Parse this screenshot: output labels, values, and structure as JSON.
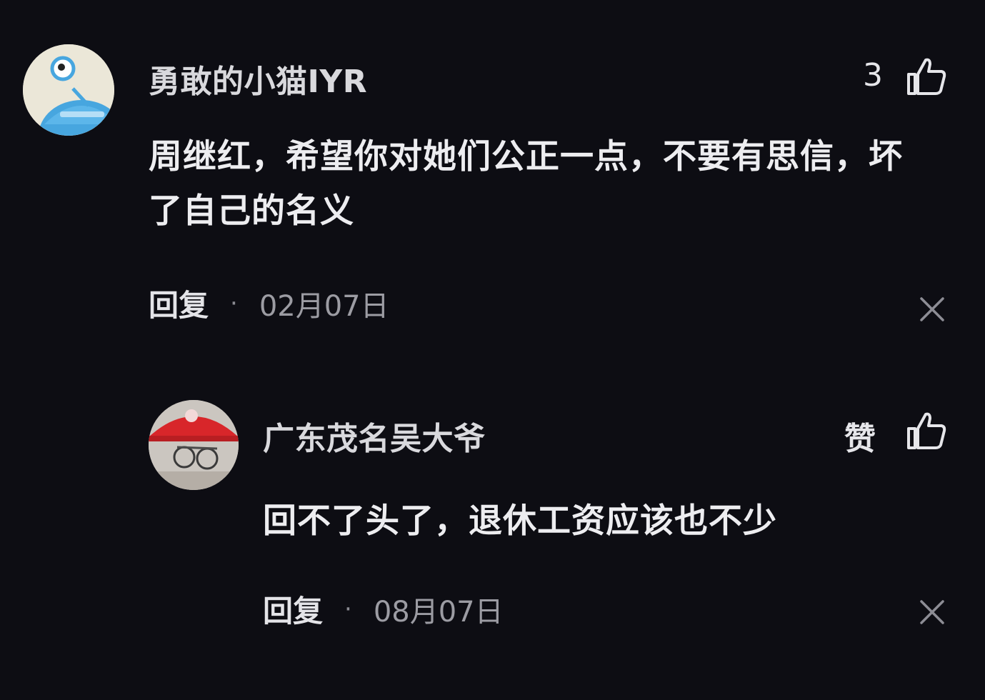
{
  "comments": [
    {
      "username": "勇敢的小猫IYR",
      "like_count": "3",
      "text": "周继红，希望你对她们公正一点，不要有思信，坏了自己的名义",
      "reply_label": "回复",
      "separator": "·",
      "date": "02月07日",
      "icons": {
        "like": "thumbs-up-icon",
        "close": "close-icon"
      }
    },
    {
      "username": "广东茂名吴大爷",
      "like_label": "赞",
      "text": "回不了头了，退休工资应该也不少",
      "reply_label": "回复",
      "separator": "·",
      "date": "08月07日",
      "icons": {
        "like": "thumbs-up-icon",
        "close": "close-icon"
      }
    }
  ],
  "colors": {
    "background": "#0d0d13",
    "text_primary": "#ededf0",
    "text_secondary": "#9c9ca3",
    "avatar1_bg": "#e9e5d6",
    "avatar1_accent": "#4aa8e0",
    "avatar2_accent": "#d8262a"
  }
}
